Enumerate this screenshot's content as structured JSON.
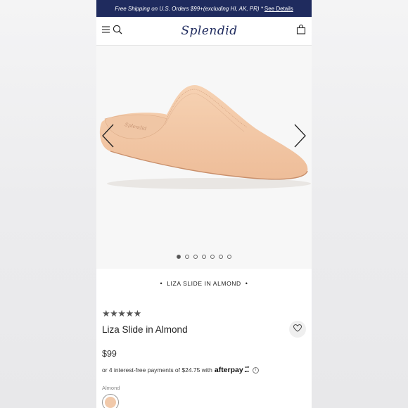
{
  "promo": {
    "text": "Free Shipping on U.S. Orders $99+(excluding HI, AK, PR) *",
    "link": "See Details"
  },
  "header": {
    "brand": "Splendid",
    "menu_icon": "menu-icon",
    "search_icon": "search-icon",
    "bag_icon": "shopping-bag-icon"
  },
  "gallery": {
    "image_count": 7,
    "active_index": 0
  },
  "caption": "LIZA SLIDE IN ALMOND",
  "product": {
    "rating_stars": "★★★★★",
    "rating": 5,
    "title": "Liza Slide in Almond",
    "price": "$99",
    "afterpay_text": "or 4 interest-free payments of $24.75 with",
    "afterpay_brand": "afterpay",
    "color_label": "Almond",
    "swatch_color": "#f1c9aa"
  },
  "colors": {
    "promo_bg": "#1f2b5e",
    "brand": "#1f2b5e"
  }
}
